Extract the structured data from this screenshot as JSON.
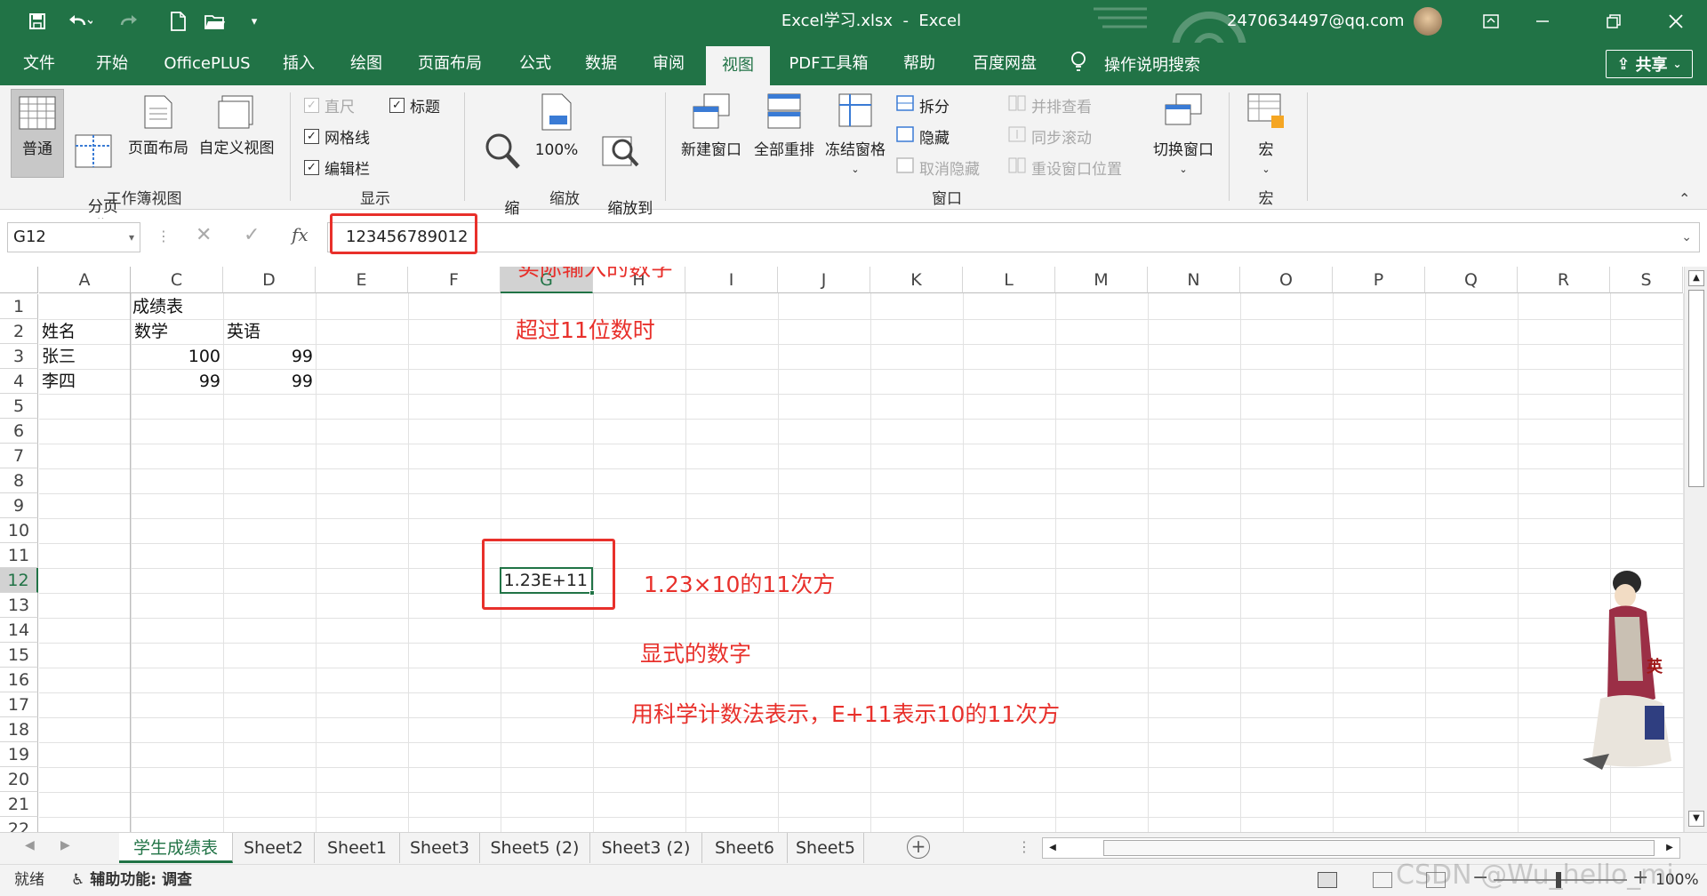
{
  "app": {
    "title": "Excel学习.xlsx  -  Excel",
    "account": "2470634497@qq.com"
  },
  "qat": {
    "save": "save-icon",
    "undo": "undo-icon",
    "redo": "redo-icon",
    "new": "new-file-icon",
    "open": "open-folder-icon",
    "more": "customize-icon"
  },
  "tabs": [
    {
      "label": "文件"
    },
    {
      "label": "开始"
    },
    {
      "label": "OfficePLUS"
    },
    {
      "label": "插入"
    },
    {
      "label": "绘图"
    },
    {
      "label": "页面布局"
    },
    {
      "label": "公式"
    },
    {
      "label": "数据"
    },
    {
      "label": "审阅"
    },
    {
      "label": "视图",
      "active": true
    },
    {
      "label": "PDF工具箱"
    },
    {
      "label": "帮助"
    },
    {
      "label": "百度网盘"
    }
  ],
  "tellme": "操作说明搜索",
  "share": "共享",
  "ribbon": {
    "views": {
      "normal": "普通",
      "pagebreak": "分页\n预览",
      "pagelayout": "页面布局",
      "custom": "自定义视图",
      "group": "工作簿视图"
    },
    "show": {
      "ruler": "直尺",
      "gridlines": "网格线",
      "formulabar": "编辑栏",
      "headings": "标题",
      "group": "显示",
      "ruler_checked": true,
      "gridlines_checked": true,
      "formulabar_checked": true,
      "headings_checked": true
    },
    "zoom": {
      "zoom": "缩\n放",
      "hundred": "100%",
      "selection": "缩放到\n选定区域",
      "group": "缩放"
    },
    "window": {
      "newwin": "新建窗口",
      "arrange": "全部重排",
      "freeze": "冻结窗格",
      "split": "拆分",
      "hide": "隐藏",
      "unhide": "取消隐藏",
      "sidebyside": "并排查看",
      "syncscroll": "同步滚动",
      "reset": "重设窗口位置",
      "switch": "切换窗口",
      "group": "窗口"
    },
    "macro": {
      "macros": "宏",
      "group": "宏"
    }
  },
  "formula": {
    "namebox": "G12",
    "fx": "fx",
    "value": "123456789012"
  },
  "columns": [
    "A",
    "C",
    "D",
    "E",
    "F",
    "G",
    "H",
    "I",
    "J",
    "K",
    "L",
    "M",
    "N",
    "O",
    "P",
    "Q",
    "R",
    "S"
  ],
  "rows": [
    "1",
    "2",
    "3",
    "4",
    "5",
    "6",
    "7",
    "8",
    "9",
    "10",
    "11",
    "12",
    "13",
    "14",
    "15",
    "16",
    "17",
    "18",
    "19",
    "20",
    "21",
    "22"
  ],
  "cells": {
    "c1": "成绩表",
    "a2": "姓名",
    "c2": "数学",
    "d2": "英语",
    "a3": "张三",
    "c3": "100",
    "d3": "99",
    "a4": "李四",
    "c4": "99",
    "d4": "99",
    "g12": "1.23E+11"
  },
  "notes": {
    "n1": "实际输入的数字",
    "n2": "超过11位数时",
    "n3": "1.23×10的11次方",
    "n4": "显式的数字",
    "n5": "用科学计数法表示，E+11表示10的11次方"
  },
  "sheets": [
    {
      "label": "学生成绩表",
      "active": true
    },
    {
      "label": "Sheet2"
    },
    {
      "label": "Sheet1"
    },
    {
      "label": "Sheet3"
    },
    {
      "label": "Sheet5 (2)"
    },
    {
      "label": "Sheet3 (2)"
    },
    {
      "label": "Sheet6"
    },
    {
      "label": "Sheet5"
    }
  ],
  "status": {
    "ready": "就绪",
    "accessibility": "辅助功能: 调查",
    "zoom": "100%",
    "watermark": "CSDN @Wu_hello_mi",
    "stamp": "英"
  }
}
